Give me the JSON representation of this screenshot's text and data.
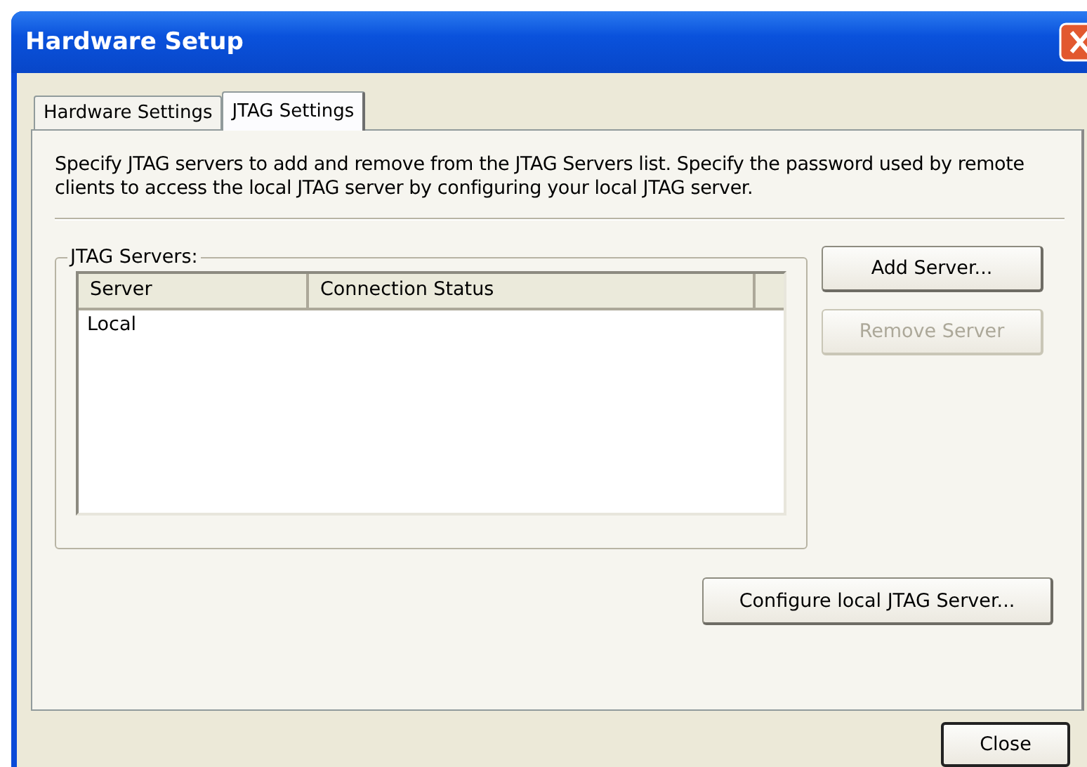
{
  "window": {
    "title": "Hardware Setup"
  },
  "tabs": [
    {
      "label": "Hardware Settings",
      "selected": false
    },
    {
      "label": "JTAG Settings",
      "selected": true
    }
  ],
  "description": "Specify JTAG servers to add and remove from the JTAG Servers list. Specify the password used by remote clients to access the local JTAG server by configuring your local JTAG server.",
  "group": {
    "label": "JTAG Servers:"
  },
  "table": {
    "columns": [
      "Server",
      "Connection Status"
    ],
    "rows": [
      [
        "Local",
        ""
      ]
    ]
  },
  "side_buttons": [
    {
      "label": "Add Server...",
      "disabled": false
    },
    {
      "label": "Remove Server",
      "disabled": true
    }
  ],
  "configure_button": {
    "label": "Configure local JTAG Server..."
  },
  "close_button": {
    "label": "Close"
  }
}
